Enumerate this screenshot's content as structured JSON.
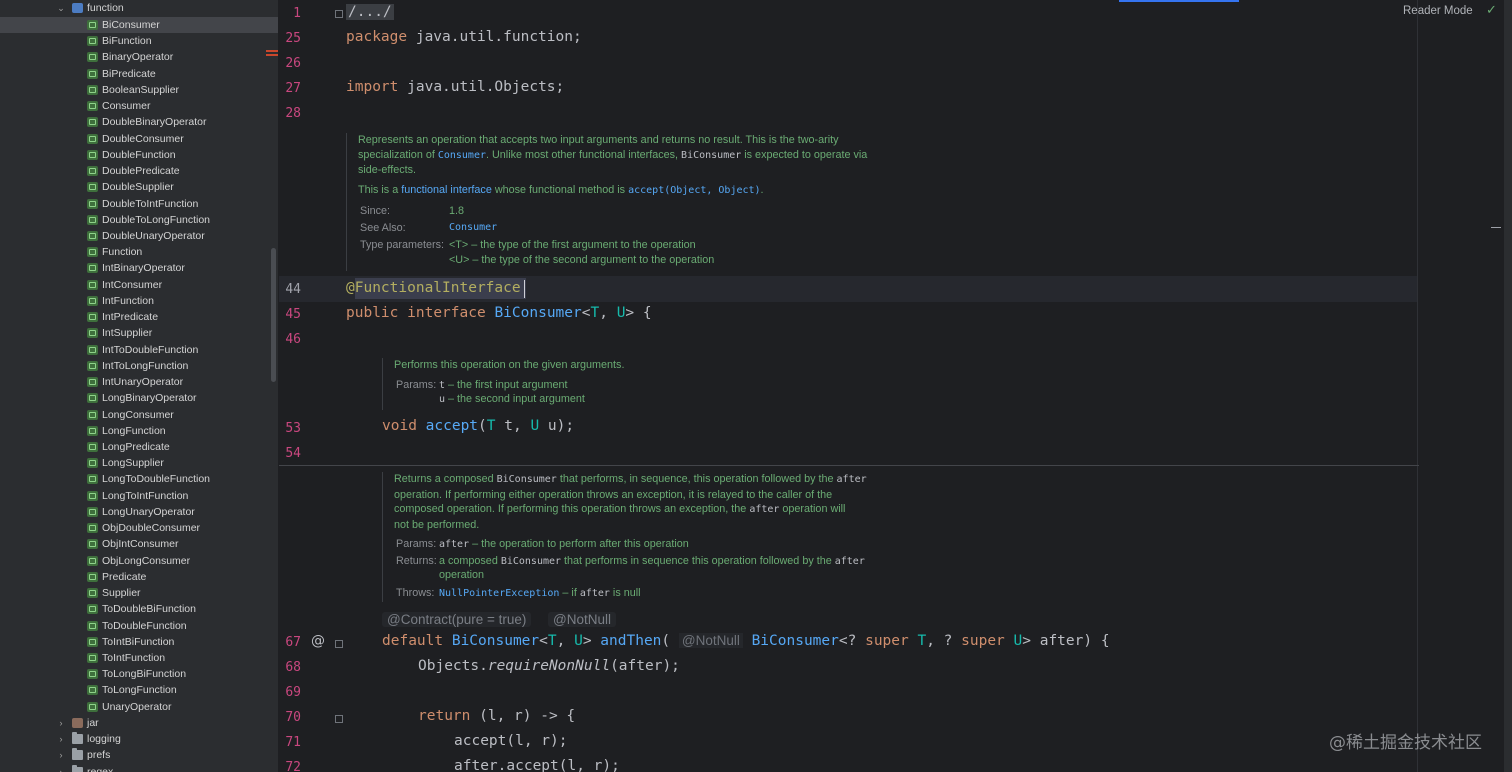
{
  "sidebar": {
    "root": "function",
    "items": [
      "BiConsumer",
      "BiFunction",
      "BinaryOperator",
      "BiPredicate",
      "BooleanSupplier",
      "Consumer",
      "DoubleBinaryOperator",
      "DoubleConsumer",
      "DoubleFunction",
      "DoublePredicate",
      "DoubleSupplier",
      "DoubleToIntFunction",
      "DoubleToLongFunction",
      "DoubleUnaryOperator",
      "Function",
      "IntBinaryOperator",
      "IntConsumer",
      "IntFunction",
      "IntPredicate",
      "IntSupplier",
      "IntToDoubleFunction",
      "IntToLongFunction",
      "IntUnaryOperator",
      "LongBinaryOperator",
      "LongConsumer",
      "LongFunction",
      "LongPredicate",
      "LongSupplier",
      "LongToDoubleFunction",
      "LongToIntFunction",
      "LongUnaryOperator",
      "ObjDoubleConsumer",
      "ObjIntConsumer",
      "ObjLongConsumer",
      "Predicate",
      "Supplier",
      "ToDoubleBiFunction",
      "ToDoubleFunction",
      "ToIntBiFunction",
      "ToIntFunction",
      "ToLongBiFunction",
      "ToLongFunction",
      "UnaryOperator"
    ],
    "selected": "BiConsumer",
    "folders": [
      "jar",
      "logging",
      "prefs",
      "regex"
    ]
  },
  "editor": {
    "reader_mode": "Reader Mode",
    "line_numbers": {
      "l1": "1",
      "l25": "25",
      "l26": "26",
      "l27": "27",
      "l28": "28",
      "l44": "44",
      "l45": "45",
      "l46": "46",
      "l53": "53",
      "l54": "54",
      "l67": "67",
      "l68": "68",
      "l69": "69",
      "l70": "70",
      "l71": "71",
      "l72": "72"
    },
    "code": {
      "folded": "/.../",
      "package_kw": "package",
      "package_name": "java.util.function;",
      "import_kw": "import",
      "import_name": "java.util.Objects;",
      "annotation": "@FunctionalInterface",
      "public_kw": "public",
      "interface_kw": "interface",
      "class_name": "BiConsumer",
      "type_params_open": "<",
      "tp_T": "T",
      "comma": ", ",
      "tp_U": "U",
      "type_params_close": "> {",
      "void_kw": "void",
      "accept_name": "accept",
      "accept_params_open": "(",
      "accept_t": " t, ",
      "accept_u": " u);",
      "default_kw": "default",
      "andthen_ret": "BiConsumer",
      "andthen_name": "andThen",
      "inlay_notnull_param": "@NotNull",
      "andthen_param_type": "BiConsumer",
      "super_kw": "super",
      "q_mark": "<? ",
      "andthen_tail": "> after) {",
      "objects": "Objects.",
      "require": "requireNonNull",
      "require_args": "(after);",
      "return_kw": "return",
      "lambda": " (l, r) -> {",
      "accept_call": "accept(l, r);",
      "after_call": "after.accept(l, r);"
    },
    "inlay_contract": "@Contract(pure = true)",
    "inlay_notnull": "@NotNull",
    "doc1": {
      "line1": "Represents an operation that accepts two input arguments and returns no result. This is the two-arity",
      "line2a": "specialization of ",
      "line2_link": "Consumer",
      "line2b": ". Unlike most other functional interfaces, ",
      "line2_code": "BiConsumer",
      "line2c": " is expected to operate via",
      "line3": "side-effects.",
      "line4a": "This is a ",
      "line4_link": "functional interface",
      "line4b": " whose functional method is ",
      "line4_code": "accept(Object, Object)",
      "line4c": ".",
      "since_label": "Since:",
      "since_value": "1.8",
      "see_label": "See Also:",
      "see_value": "Consumer",
      "tparam_label": "Type parameters:",
      "tparam_T": "<T> – the type of the first argument to the operation",
      "tparam_U": "<U> – the type of the second argument to the operation"
    },
    "doc2": {
      "line1": "Performs this operation on the given arguments.",
      "params_label": "Params:",
      "p1_name": "t",
      "p1_desc": " – the first input argument",
      "p2_name": "u",
      "p2_desc": " – the second input argument"
    },
    "doc3": {
      "line1a": "Returns a composed ",
      "line1_code": "BiConsumer",
      "line1b": " that performs, in sequence, this operation followed by the ",
      "line1_code2": "after",
      "line2": "operation. If performing either operation throws an exception, it is relayed to the caller of the",
      "line3a": "composed operation. If performing this operation throws an exception, the ",
      "line3_code": "after",
      "line3b": " operation will",
      "line4": "not be performed.",
      "params_label": "Params:",
      "param_name": "after",
      "param_desc": " – the operation to perform after this operation",
      "returns_label": "Returns:",
      "returns_a": "a composed ",
      "returns_code": "BiConsumer",
      "returns_b": " that performs in sequence this operation followed by the ",
      "returns_code2": "after",
      "returns_c": "operation",
      "throws_label": "Throws:",
      "throws_link": "NullPointerException",
      "throws_a": " – if ",
      "throws_code": "after",
      "throws_b": " is null"
    },
    "gutter_at": "@",
    "watermark": "@稀土掘金技术社区"
  }
}
